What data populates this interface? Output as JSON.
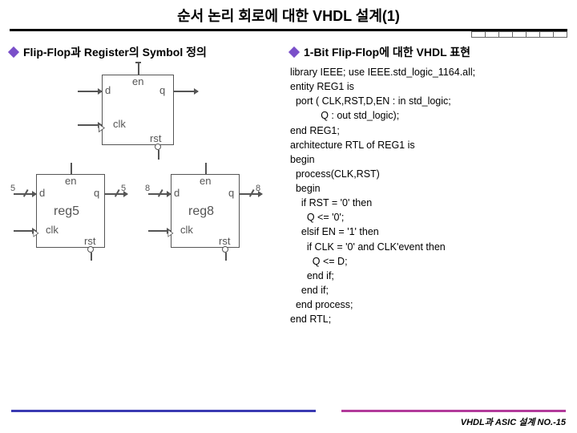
{
  "title": "순서 논리 회로에 대한 VHDL 설계(1)",
  "left_heading": "Flip-Flop과 Register의 Symbol 정의",
  "right_heading": "1-Bit Flip-Flop에 대한 VHDL 표현",
  "code": "library IEEE; use IEEE.std_logic_1164.all;\nentity REG1 is\n  port ( CLK,RST,D,EN : in std_logic;\n           Q : out std_logic);\nend REG1;\narchitecture RTL of REG1 is\nbegin\n  process(CLK,RST)\n  begin\n    if RST = '0' then\n      Q <= '0';\n    elsif EN = '1' then\n      if CLK = '0' and CLK'event then\n        Q <= D;\n      end if;\n    end if;\n  end process;\nend RTL;",
  "dff": {
    "en": "en",
    "d": "d",
    "q": "q",
    "clk": "clk",
    "rst": "rst"
  },
  "reg5": {
    "name": "reg5",
    "en": "en",
    "d": "d",
    "q": "q",
    "clk": "clk",
    "rst": "rst",
    "width_in": "5",
    "width_out": "5"
  },
  "reg8": {
    "name": "reg8",
    "en": "en",
    "d": "d",
    "q": "q",
    "clk": "clk",
    "rst": "rst",
    "width_in": "8",
    "width_out": "8"
  },
  "footer": "VHDL과 ASIC 설계  NO.-15"
}
